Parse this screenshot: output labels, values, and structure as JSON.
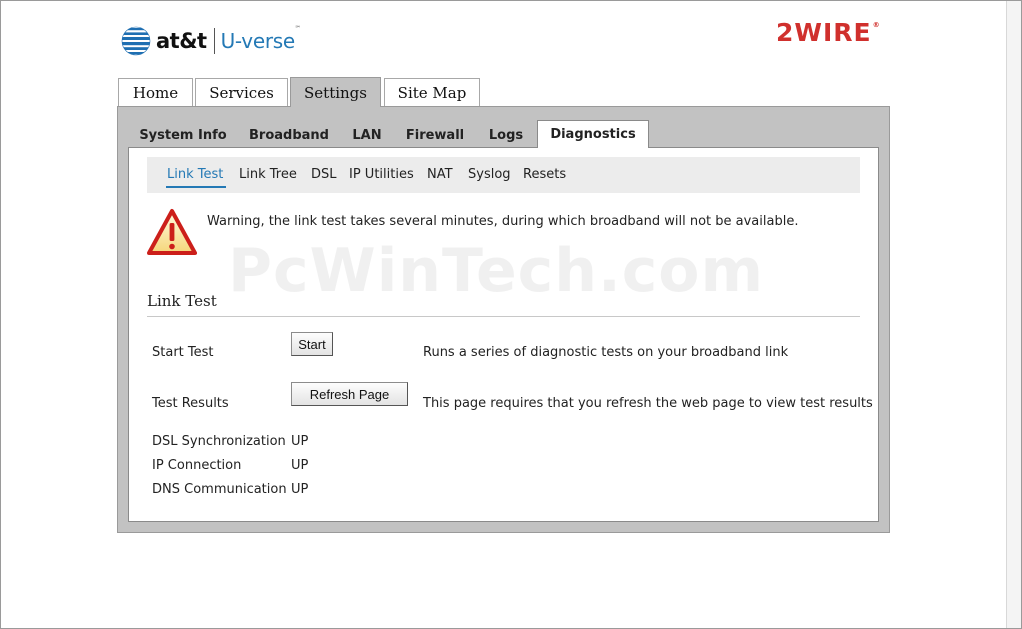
{
  "header": {
    "att_text": "at&t",
    "uverse_text": "U-verse",
    "uverse_tm": "℠",
    "brand_text": "2WIRE",
    "brand_reg": "®"
  },
  "top_tabs": [
    {
      "label": "Home",
      "active": false
    },
    {
      "label": "Services",
      "active": false
    },
    {
      "label": "Settings",
      "active": true
    },
    {
      "label": "Site Map",
      "active": false
    }
  ],
  "sub_tabs": [
    {
      "label": "System Info",
      "active": false
    },
    {
      "label": "Broadband",
      "active": false
    },
    {
      "label": "LAN",
      "active": false
    },
    {
      "label": "Firewall",
      "active": false
    },
    {
      "label": "Logs",
      "active": false
    },
    {
      "label": "Diagnostics",
      "active": true
    }
  ],
  "sub_nav": [
    {
      "label": "Link Test",
      "active": true
    },
    {
      "label": "Link Tree",
      "active": false
    },
    {
      "label": "DSL",
      "active": false
    },
    {
      "label": "IP Utilities",
      "active": false
    },
    {
      "label": "NAT",
      "active": false
    },
    {
      "label": "Syslog",
      "active": false
    },
    {
      "label": "Resets",
      "active": false
    }
  ],
  "warning": {
    "text": "Warning, the link test takes several minutes, during which broadband will not be available."
  },
  "watermark": "PcWinTech.com",
  "link_test": {
    "title": "Link Test",
    "start_test_label": "Start Test",
    "start_button": "Start",
    "start_desc": "Runs a series of diagnostic tests on your broadband link",
    "results_label": "Test Results",
    "refresh_button": "Refresh Page",
    "results_desc": "This page requires that you refresh the web page to view test results",
    "statuses": [
      {
        "label": "DSL Synchronization",
        "value": "UP"
      },
      {
        "label": "IP Connection",
        "value": "UP"
      },
      {
        "label": "DNS Communication",
        "value": "UP"
      }
    ]
  },
  "colors": {
    "accent_blue": "#2479b5",
    "brand_red": "#d0302d",
    "panel_gray": "#c2c2c2",
    "warning_red": "#cc1f1a"
  }
}
